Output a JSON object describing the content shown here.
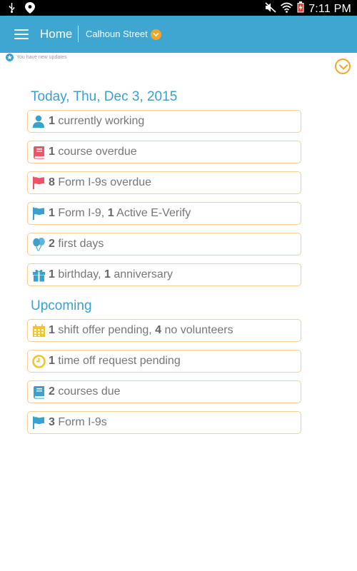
{
  "colors": {
    "app_bar": "#3fa6d2",
    "accent_blue": "#3aa0cd",
    "card_border": "#f6cd92",
    "orange": "#f5a623",
    "red": "#ef5366",
    "gold": "#f2c428",
    "text": "#777777",
    "status_bar": "#000000"
  },
  "status_bar": {
    "time": "7:11 PM",
    "left_icons": [
      "usb-icon",
      "location-pin-icon"
    ],
    "right_icons": [
      "mute-icon",
      "wifi-icon",
      "battery-charging-icon"
    ]
  },
  "app_bar": {
    "title": "Home",
    "location": "Calhoun Street",
    "menu_icon": "hamburger-menu-icon",
    "location_icon": "chevron-down-icon"
  },
  "updates": {
    "text": "You have new updates",
    "icon": "star-badge-icon",
    "expand_icon": "chevron-down-circle-icon"
  },
  "today": {
    "title": "Today, Thu, Dec 3, 2015",
    "items": [
      {
        "icon": "person-icon",
        "parts": [
          {
            "v": "1",
            "b": true
          },
          {
            "v": " currently working",
            "b": false
          }
        ]
      },
      {
        "icon": "book-icon",
        "parts": [
          {
            "v": "1",
            "b": true
          },
          {
            "v": " course overdue",
            "b": false
          }
        ]
      },
      {
        "icon": "flag-icon",
        "parts": [
          {
            "v": "8",
            "b": true
          },
          {
            "v": " Form I-9s overdue",
            "b": false
          }
        ]
      },
      {
        "icon": "flag-icon",
        "parts": [
          {
            "v": "1",
            "b": true
          },
          {
            "v": " Form I-9, ",
            "b": false
          },
          {
            "v": "1",
            "b": true
          },
          {
            "v": " Active E-Verify",
            "b": false
          }
        ]
      },
      {
        "icon": "balloons-icon",
        "parts": [
          {
            "v": "2",
            "b": true
          },
          {
            "v": " first days",
            "b": false
          }
        ]
      },
      {
        "icon": "gift-icon",
        "parts": [
          {
            "v": "1",
            "b": true
          },
          {
            "v": " birthday, ",
            "b": false
          },
          {
            "v": "1",
            "b": true
          },
          {
            "v": " anniversary",
            "b": false
          }
        ]
      }
    ]
  },
  "upcoming": {
    "title": "Upcoming",
    "items": [
      {
        "icon": "calendar-icon",
        "parts": [
          {
            "v": "1",
            "b": true
          },
          {
            "v": " shift offer pending, ",
            "b": false
          },
          {
            "v": "4",
            "b": true
          },
          {
            "v": " no volunteers",
            "b": false
          }
        ]
      },
      {
        "icon": "clock-icon",
        "parts": [
          {
            "v": "1",
            "b": true
          },
          {
            "v": " time off request pending",
            "b": false
          }
        ]
      },
      {
        "icon": "book-icon",
        "parts": [
          {
            "v": "2",
            "b": true
          },
          {
            "v": " courses due",
            "b": false
          }
        ]
      },
      {
        "icon": "flag-icon",
        "parts": [
          {
            "v": "3",
            "b": true
          },
          {
            "v": " Form I-9s",
            "b": false
          }
        ]
      }
    ]
  }
}
